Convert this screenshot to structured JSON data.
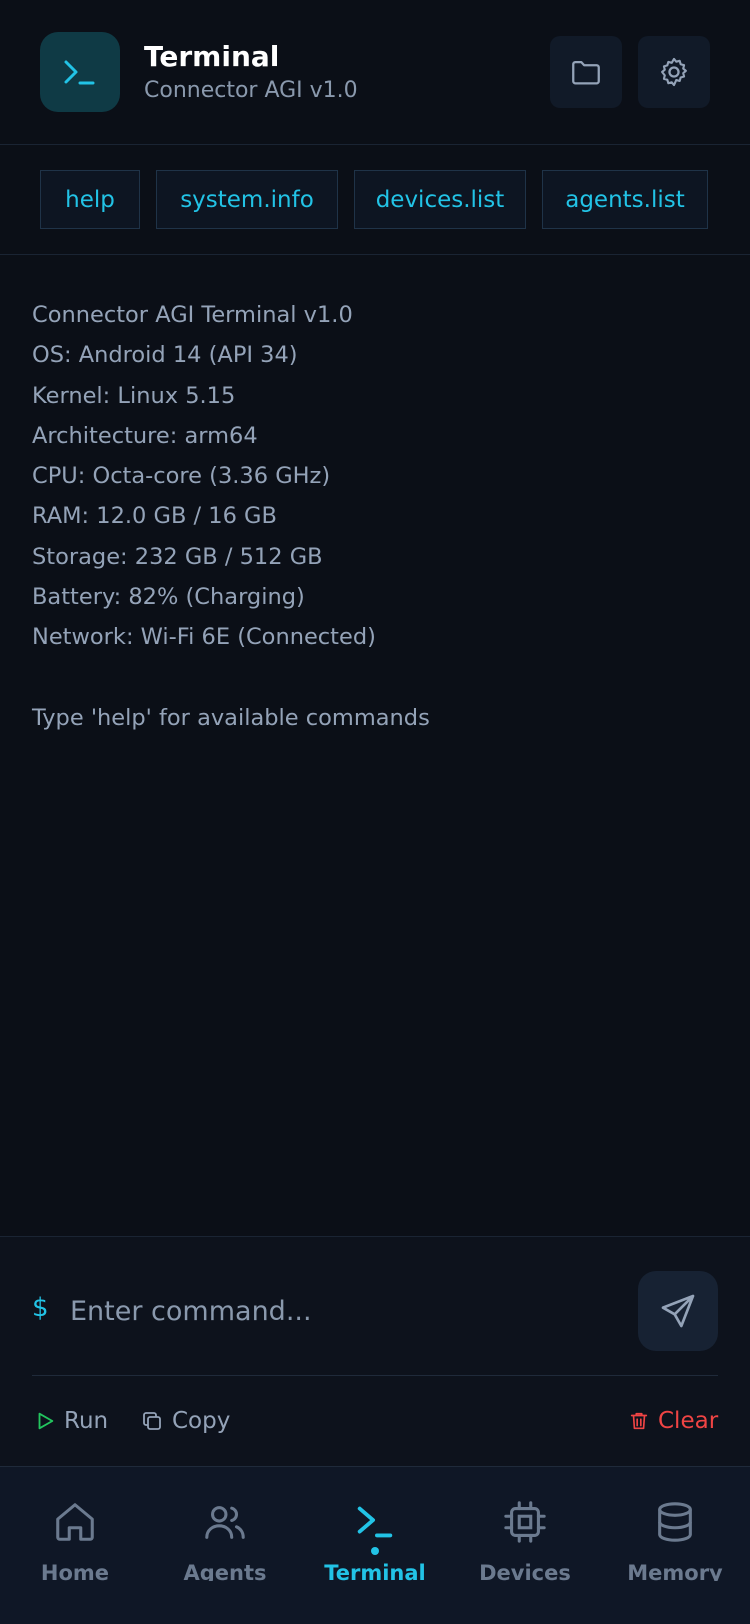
{
  "header": {
    "title": "Terminal",
    "subtitle": "Connector AGI v1.0",
    "app_icon": "terminal-icon",
    "actions": [
      {
        "icon": "folder-icon"
      },
      {
        "icon": "gear-icon"
      }
    ]
  },
  "quick_commands": [
    "help",
    "system.info",
    "devices.list",
    "agents.list"
  ],
  "output": [
    "Connector AGI Terminal v1.0",
    "OS: Android 14 (API 34)",
    "Kernel: Linux 5.15",
    "Architecture: arm64",
    "CPU: Octa-core (3.36 GHz)",
    "RAM: 12.0 GB / 16 GB",
    "Storage: 232 GB / 512 GB",
    "Battery: 82% (Charging)",
    "Network: Wi-Fi 6E (Connected)",
    "",
    "Type 'help' for available commands"
  ],
  "input": {
    "prompt": "$",
    "value": "",
    "placeholder": "Enter command..."
  },
  "actions": {
    "run": "Run",
    "copy": "Copy",
    "clear": "Clear"
  },
  "nav": {
    "items": [
      {
        "label": "Home",
        "icon": "home-icon"
      },
      {
        "label": "Agents",
        "icon": "users-icon"
      },
      {
        "label": "Terminal",
        "icon": "terminal-icon",
        "active": true
      },
      {
        "label": "Devices",
        "icon": "cpu-icon"
      },
      {
        "label": "Memory",
        "icon": "database-icon"
      }
    ]
  },
  "colors": {
    "accent": "#22c3e6",
    "background": "#0b0f17",
    "danger": "#ef4444",
    "run": "#22c55e",
    "text_muted": "#94a3b8"
  }
}
